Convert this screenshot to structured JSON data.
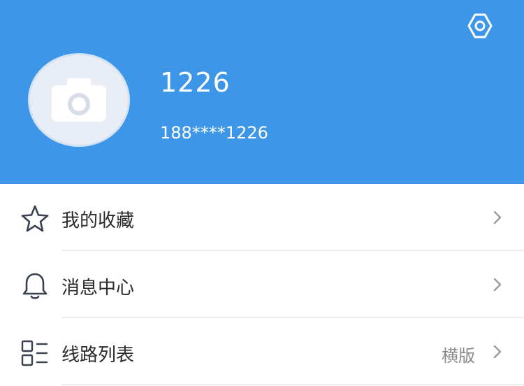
{
  "profile": {
    "username": "1226",
    "phone": "188****1226",
    "avatar_icon": "camera-icon"
  },
  "header": {
    "settings_icon": "gear-icon",
    "background_color": "#3d96e8"
  },
  "menu": {
    "items": [
      {
        "label": "我的收藏",
        "icon": "star-icon",
        "value": ""
      },
      {
        "label": "消息中心",
        "icon": "bell-icon",
        "value": ""
      },
      {
        "label": "线路列表",
        "icon": "list-icon",
        "value": "横版"
      }
    ]
  }
}
